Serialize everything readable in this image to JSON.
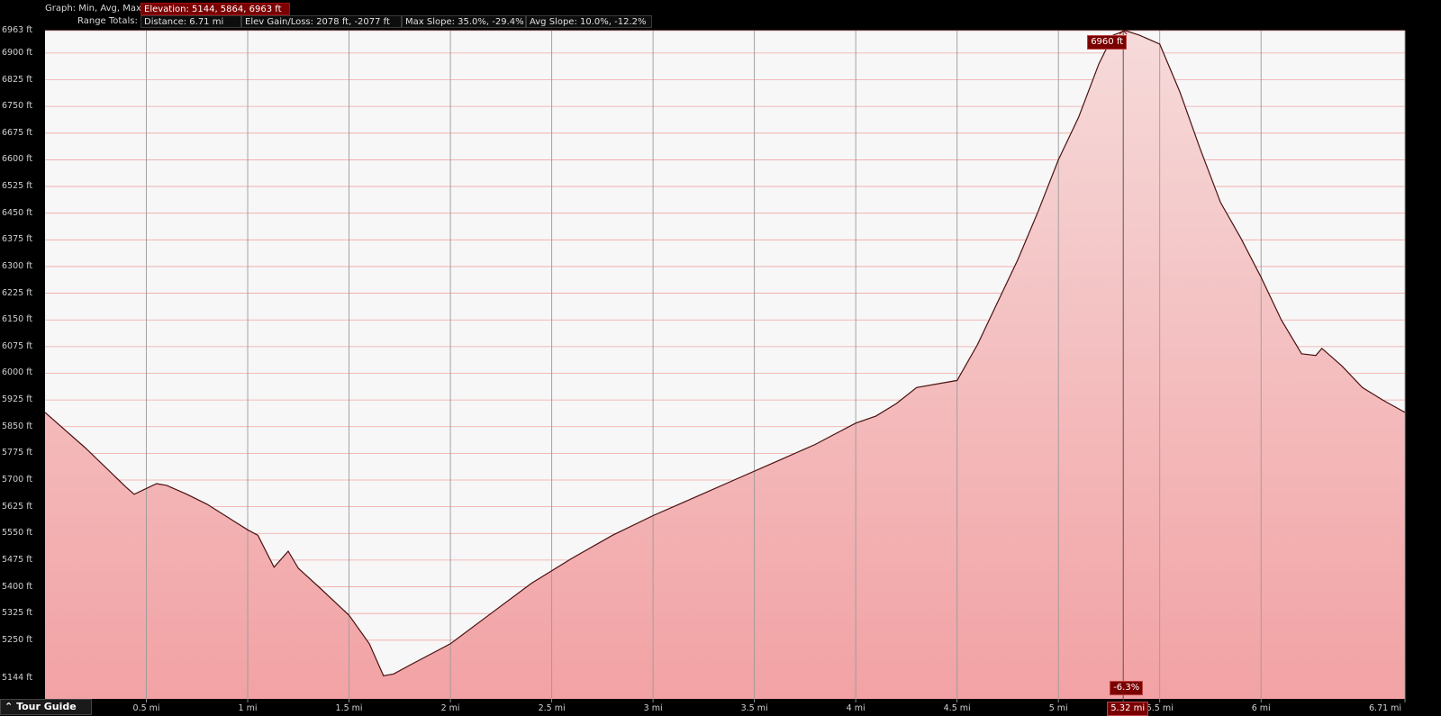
{
  "header": {
    "graph_label": "Graph: Min, Avg, Max",
    "elevation": "Elevation: 5144, 5864, 6963 ft",
    "range_label": "Range Totals:",
    "distance": "Distance: 6.71 mi",
    "elev_gain_loss": "Elev Gain/Loss: 2078 ft, -2077 ft",
    "max_slope": "Max Slope: 35.0%, -29.4%",
    "avg_slope": "Avg Slope: 10.0%, -12.2%"
  },
  "cursor": {
    "elevation_label": "6960 ft",
    "slope_label": "-6.3%",
    "distance_label": "5.32 mi",
    "distance_value": 5.32
  },
  "footer": {
    "tour_guide_label": "Tour Guide",
    "tour_guide_icon": "chevron-up-icon"
  },
  "colors": {
    "fill_top": "#f6dada",
    "fill_bottom": "#f2a2a4",
    "line": "#4a1010",
    "grid_h": "#f2a6a6",
    "grid_v": "#9a9a9a",
    "plot_bg": "#f7f7f7",
    "cursor": "#7a0000"
  },
  "chart_data": {
    "type": "area",
    "xlabel": "",
    "ylabel": "",
    "xlim": [
      0,
      6.71
    ],
    "ylim": [
      5085,
      6963
    ],
    "grid": true,
    "yticks": [
      5144,
      5250,
      5325,
      5400,
      5475,
      5550,
      5625,
      5700,
      5775,
      5850,
      5925,
      6000,
      6075,
      6150,
      6225,
      6300,
      6375,
      6450,
      6525,
      6600,
      6675,
      6750,
      6825,
      6900,
      6963
    ],
    "ytick_labels": [
      "5144 ft",
      "5250 ft",
      "5325 ft",
      "5400 ft",
      "5475 ft",
      "5550 ft",
      "5625 ft",
      "5700 ft",
      "5775 ft",
      "5850 ft",
      "5925 ft",
      "6000 ft",
      "6075 ft",
      "6150 ft",
      "6225 ft",
      "6300 ft",
      "6375 ft",
      "6450 ft",
      "6525 ft",
      "6600 ft",
      "6675 ft",
      "6750 ft",
      "6825 ft",
      "6900 ft",
      "6963 ft"
    ],
    "xticks": [
      0.5,
      1,
      1.5,
      2,
      2.5,
      3,
      3.5,
      4,
      4.5,
      5,
      5.5,
      6,
      6.71
    ],
    "xtick_labels": [
      "0.5 mi",
      "1 mi",
      "1.5 mi",
      "2 mi",
      "2.5 mi",
      "3 mi",
      "3.5 mi",
      "4 mi",
      "4.5 mi",
      "5 mi",
      "5.5 mi",
      "6 mi",
      "6.71 mi"
    ],
    "series": [
      {
        "x": [
          0,
          0.2,
          0.4,
          0.44,
          0.55,
          0.6,
          0.7,
          0.8,
          1.0,
          1.05,
          1.13,
          1.2,
          1.25,
          1.35,
          1.5,
          1.6,
          1.67,
          1.72,
          1.8,
          1.9,
          2.0,
          2.2,
          2.4,
          2.6,
          2.8,
          3.0,
          3.2,
          3.4,
          3.6,
          3.8,
          3.9,
          4.0,
          4.1,
          4.2,
          4.3,
          4.5,
          4.6,
          4.7,
          4.8,
          4.9,
          5.0,
          5.1,
          5.2,
          5.27,
          5.33,
          5.4,
          5.5,
          5.6,
          5.7,
          5.8,
          5.9,
          6.0,
          6.1,
          6.2,
          6.27,
          6.3,
          6.35,
          6.4,
          6.5,
          6.6,
          6.71
        ],
        "y": [
          5890,
          5790,
          5680,
          5660,
          5690,
          5685,
          5660,
          5632,
          5560,
          5545,
          5455,
          5500,
          5452,
          5400,
          5320,
          5240,
          5150,
          5155,
          5180,
          5210,
          5240,
          5325,
          5410,
          5480,
          5545,
          5600,
          5650,
          5700,
          5750,
          5800,
          5830,
          5860,
          5880,
          5915,
          5960,
          5980,
          6080,
          6200,
          6320,
          6455,
          6600,
          6720,
          6870,
          6950,
          6963,
          6950,
          6925,
          6790,
          6630,
          6480,
          6380,
          6270,
          6150,
          6055,
          6050,
          6070,
          6045,
          6020,
          5960,
          5925,
          5890
        ]
      }
    ]
  }
}
